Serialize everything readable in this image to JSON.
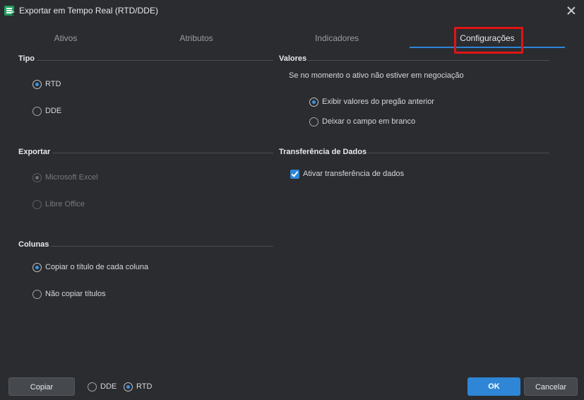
{
  "window": {
    "title": "Exportar em Tempo Real (RTD/DDE)"
  },
  "tabs": [
    {
      "label": "Ativos"
    },
    {
      "label": "Atributos"
    },
    {
      "label": "Indicadores"
    },
    {
      "label": "Configurações",
      "active": true
    }
  ],
  "tipo": {
    "title": "Tipo",
    "options": [
      {
        "label": "RTD",
        "checked": true
      },
      {
        "label": "DDE",
        "checked": false
      }
    ]
  },
  "exportar": {
    "title": "Exportar",
    "options": [
      {
        "label": "Microsoft Excel",
        "checked": true,
        "disabled": true
      },
      {
        "label": "Libre Office",
        "checked": false,
        "disabled": true
      }
    ]
  },
  "colunas": {
    "title": "Colunas",
    "options": [
      {
        "label": "Copiar o título de cada coluna",
        "checked": true
      },
      {
        "label": "Não copiar títulos",
        "checked": false
      }
    ]
  },
  "valores": {
    "title": "Valores",
    "description": "Se no momento o ativo não estiver em negociação",
    "options": [
      {
        "label": "Exibir valores do pregão anterior",
        "checked": true
      },
      {
        "label": "Deixar o campo em branco",
        "checked": false
      }
    ]
  },
  "transferencia": {
    "title": "Transferência de Dados",
    "checkbox_label": "Ativar transferência de dados",
    "checked": true
  },
  "footer": {
    "copy_label": "Copiar",
    "mode_options": [
      {
        "label": "DDE",
        "checked": false
      },
      {
        "label": "RTD",
        "checked": true
      }
    ],
    "ok_label": "OK",
    "cancel_label": "Cancelar"
  },
  "colors": {
    "background": "#2a2c30",
    "accent": "#2f86d6",
    "highlight": "#e11414"
  }
}
